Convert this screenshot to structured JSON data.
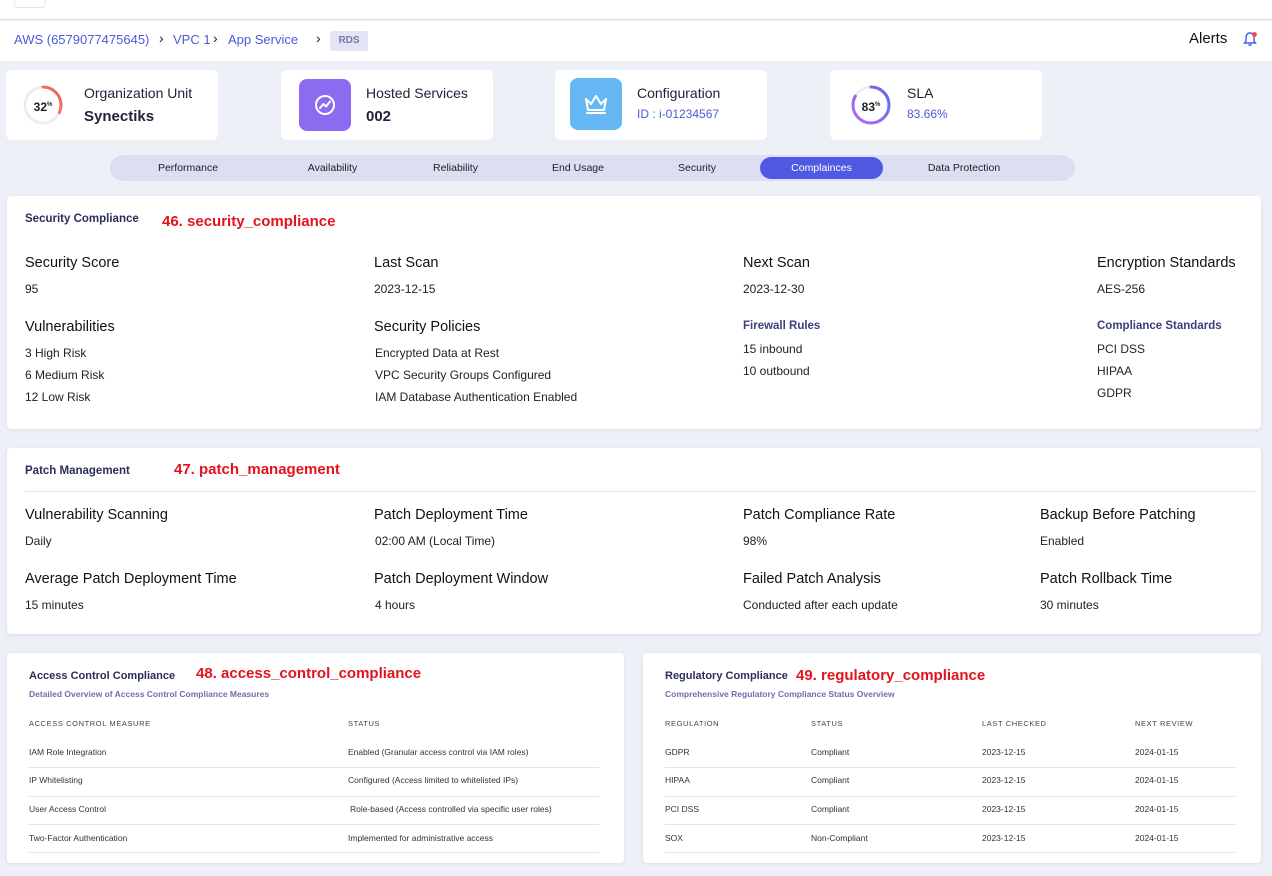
{
  "breadcrumb": {
    "items": [
      "AWS (6579077475645)",
      "VPC 1",
      "App Service"
    ],
    "current": "RDS"
  },
  "header": {
    "alerts_label": "Alerts",
    "bell_icon": "bell-icon"
  },
  "kpis": {
    "org": {
      "title": "Organization Unit",
      "value": "Synectiks",
      "ring_pct": "32",
      "ring_unit": "%",
      "ring_level": 0.32
    },
    "hosted": {
      "title": "Hosted Services",
      "value": "002",
      "icon": "trend-chart-icon",
      "icon_color": "#8b6cf0"
    },
    "config": {
      "title": "Configuration",
      "sub": "ID : i-01234567",
      "icon": "crown-icon",
      "icon_color": "#66b8f5"
    },
    "sla": {
      "title": "SLA",
      "sub": "83.66%",
      "ring_pct": "83",
      "ring_unit": "%",
      "ring_level": 0.83
    }
  },
  "tabs": [
    "Performance",
    "Availability",
    "Reliability",
    "End Usage",
    "Security",
    "Complainces",
    "Data Protection"
  ],
  "active_tab": "Complainces",
  "colors": {
    "accent": "#4f59e4",
    "annotation": "#e3131c",
    "link": "#4b5bd6"
  },
  "security": {
    "title": "Security Compliance",
    "annotation": "46. security_compliance",
    "security_score_label": "Security Score",
    "security_score": "95",
    "last_scan_label": "Last Scan",
    "last_scan": "2023-12-15",
    "next_scan_label": "Next Scan",
    "next_scan": "2023-12-30",
    "encryption_label": "Encryption Standards",
    "encryption": "AES-256",
    "vulnerabilities_label": "Vulnerabilities",
    "vulnerabilities": [
      "3 High Risk",
      "6 Medium Risk",
      "12 Low Risk"
    ],
    "policies_label": "Security Policies",
    "policies": [
      "Encrypted Data at Rest",
      "VPC Security Groups Configured",
      "IAM Database Authentication Enabled"
    ],
    "firewall_label": "Firewall Rules",
    "firewall": [
      "15 inbound",
      "10 outbound"
    ],
    "standards_label": "Compliance Standards",
    "standards": [
      "PCI DSS",
      "HIPAA",
      "GDPR"
    ]
  },
  "patch": {
    "title": "Patch Management",
    "annotation": "47. patch_management",
    "vuln_scan_label": "Vulnerability Scanning",
    "vuln_scan": "Daily",
    "deploy_time_label": "Patch Deployment Time",
    "deploy_time": "02:00 AM (Local Time)",
    "compliance_rate_label": "Patch Compliance Rate",
    "compliance_rate": "98%",
    "backup_label": "Backup Before Patching",
    "backup": "Enabled",
    "avg_time_label": "Average Patch Deployment Time",
    "avg_time": "15 minutes",
    "window_label": "Patch Deployment Window",
    "window": "4 hours",
    "failed_label": "Failed Patch Analysis",
    "failed": "Conducted after each update",
    "rollback_label": "Patch Rollback Time",
    "rollback": "30 minutes"
  },
  "access": {
    "title": "Access Control Compliance",
    "annotation": "48. access_control_compliance",
    "subtitle": "Detailed Overview of Access Control Compliance Measures",
    "headers": [
      "ACCESS CONTROL MEASURE",
      "STATUS"
    ],
    "rows": [
      [
        "IAM Role Integration",
        "Enabled (Granular access control via IAM roles)"
      ],
      [
        "IP Whitelisting",
        "Configured (Access limited to whitelisted IPs)"
      ],
      [
        "User Access Control",
        "Role-based (Access controlled via specific user roles)"
      ],
      [
        "Two-Factor Authentication",
        "Implemented for administrative access"
      ]
    ]
  },
  "regulatory": {
    "title": "Regulatory Compliance",
    "annotation": "49. regulatory_compliance",
    "subtitle": "Comprehensive Regulatory Compliance Status Overview",
    "headers": [
      "REGULATION",
      "STATUS",
      "LAST CHECKED",
      "NEXT REVIEW"
    ],
    "rows": [
      [
        "GDPR",
        "Compliant",
        "2023-12-15",
        "2024-01-15"
      ],
      [
        "HIPAA",
        "Compliant",
        "2023-12-15",
        "2024-01-15"
      ],
      [
        "PCI DSS",
        "Compliant",
        "2023-12-15",
        "2024-01-15"
      ],
      [
        "SOX",
        "Non-Compliant",
        "2023-12-15",
        "2024-01-15"
      ]
    ]
  }
}
